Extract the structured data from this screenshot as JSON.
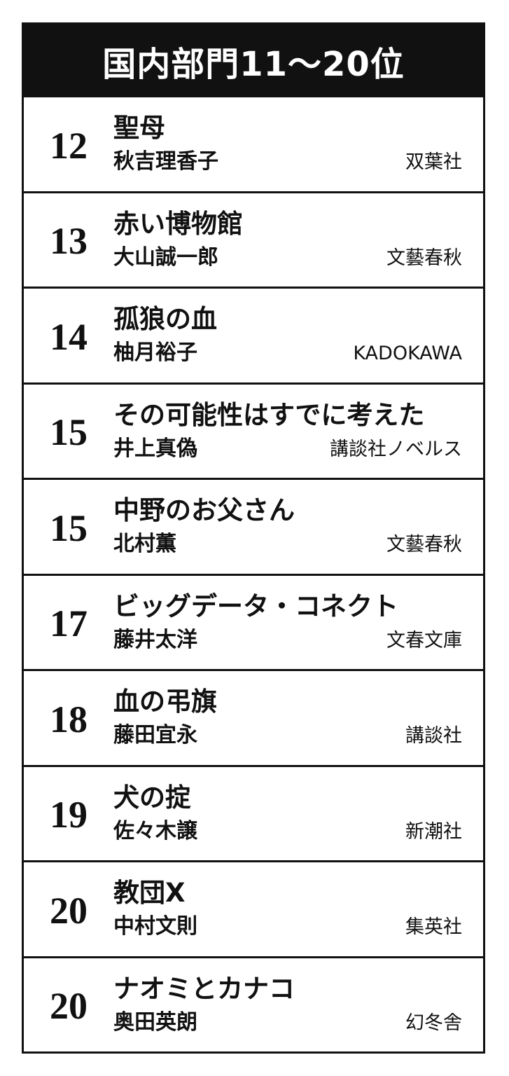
{
  "header": {
    "title": "国内部門11～20位"
  },
  "entries": [
    {
      "rank": "12",
      "title": "聖母",
      "author": "秋吉理香子",
      "publisher": "双葉社"
    },
    {
      "rank": "13",
      "title": "赤い博物館",
      "author": "大山誠一郎",
      "publisher": "文藝春秋"
    },
    {
      "rank": "14",
      "title": "孤狼の血",
      "author": "柚月裕子",
      "publisher": "KADOKAWA"
    },
    {
      "rank": "15",
      "title": "その可能性はすでに考えた",
      "author": "井上真偽",
      "publisher": "講談社ノベルス"
    },
    {
      "rank": "15",
      "title": "中野のお父さん",
      "author": "北村薫",
      "publisher": "文藝春秋"
    },
    {
      "rank": "17",
      "title": "ビッグデータ・コネクト",
      "author": "藤井太洋",
      "publisher": "文春文庫"
    },
    {
      "rank": "18",
      "title": "血の弔旗",
      "author": "藤田宜永",
      "publisher": "講談社"
    },
    {
      "rank": "19",
      "title": "犬の掟",
      "author": "佐々木譲",
      "publisher": "新潮社"
    },
    {
      "rank": "20",
      "title": "教団X",
      "author": "中村文則",
      "publisher": "集英社"
    },
    {
      "rank": "20",
      "title": "ナオミとカナコ",
      "author": "奥田英朗",
      "publisher": "幻冬舎"
    }
  ]
}
